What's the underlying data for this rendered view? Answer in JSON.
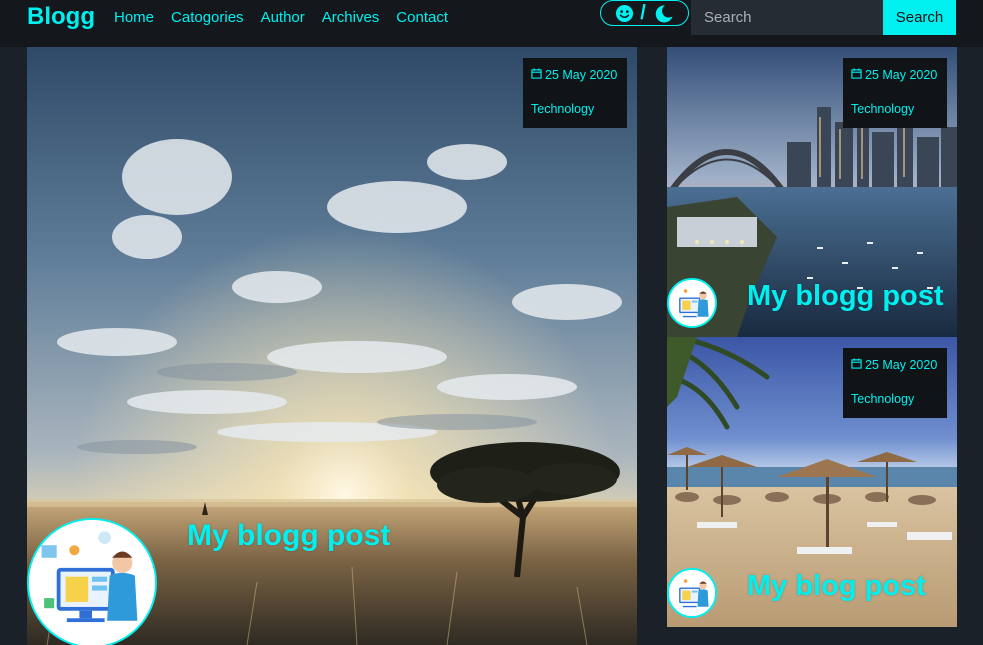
{
  "nav": {
    "brand": "Blogg",
    "links": [
      "Home",
      "Catogories",
      "Author",
      "Archives",
      "Contact"
    ],
    "theme_toggle": {
      "separator": "/",
      "light_icon": "smiley-icon",
      "dark_icon": "moon-icon"
    },
    "search": {
      "placeholder": "Search",
      "value": "",
      "button_label": "Search"
    }
  },
  "colors": {
    "accent": "#00f0f0",
    "navbar_bg": "#14181c",
    "page_bg": "#1b2128",
    "badge_bg": "#111417"
  },
  "posts": [
    {
      "date": "25 May 2020",
      "category": "Technology",
      "title": "My blogg post",
      "image": "savanna-sunset",
      "date_icon": "calendar-icon"
    },
    {
      "date": "25 May 2020",
      "category": "Technology",
      "title": "My blogg post",
      "image": "harbour-bridge-city",
      "date_icon": "calendar-icon"
    },
    {
      "date": "25 May 2020",
      "category": "Technology",
      "title": "My blog post",
      "image": "beach-umbrellas",
      "date_icon": "calendar-icon"
    }
  ]
}
